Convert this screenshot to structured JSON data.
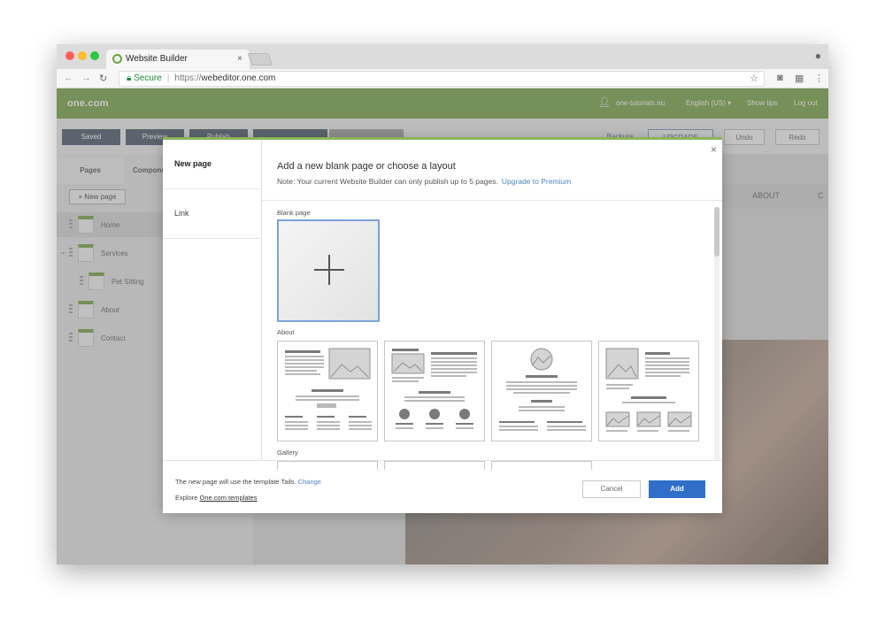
{
  "browser": {
    "tab_title": "Website Builder",
    "tab_close": "×",
    "secure_label": "Secure",
    "url_scheme": "https://",
    "url_host": "webeditor.one.com",
    "dots": [
      "#ff5f57",
      "#febc2e",
      "#28c840"
    ]
  },
  "app": {
    "logo": "one.com",
    "user": "one-tutorials.nu",
    "language": "English (US) ▾",
    "show_tips": "Show tips",
    "logout": "Log out",
    "brand_color": "#6b9b35",
    "toolbar": {
      "saved": "Saved",
      "preview": "Preview",
      "publish": "Publish",
      "backups": "Backups",
      "upgrade": "UPGRADE",
      "undo": "Undo",
      "redo": "Redo"
    }
  },
  "sidebar": {
    "tabs": [
      "Pages",
      "Components"
    ],
    "new_page": "+ New page",
    "items": [
      {
        "label": "Home"
      },
      {
        "label": "Services"
      },
      {
        "label": "Pet Sitting"
      },
      {
        "label": "About"
      },
      {
        "label": "Contact"
      }
    ]
  },
  "canvas": {
    "nav_about": "ABOUT",
    "nav_more": "C"
  },
  "modal": {
    "tabs": [
      "New page",
      "Link"
    ],
    "title": "Add a new blank page or choose a layout",
    "note": "Note: Your current Website Builder can only publish up to 5 pages.",
    "upgrade_link": "Upgrade to Premium",
    "close": "×",
    "sections": {
      "blank": "Blank page",
      "about": "About",
      "gallery": "Gallery"
    },
    "footer": {
      "template_text": "The new page will use the template Tails.",
      "change": "Change",
      "explore": "Explore",
      "templates_link": "One.com templates"
    },
    "cancel": "Cancel",
    "add": "Add",
    "add_color": "#2f6fc9"
  }
}
